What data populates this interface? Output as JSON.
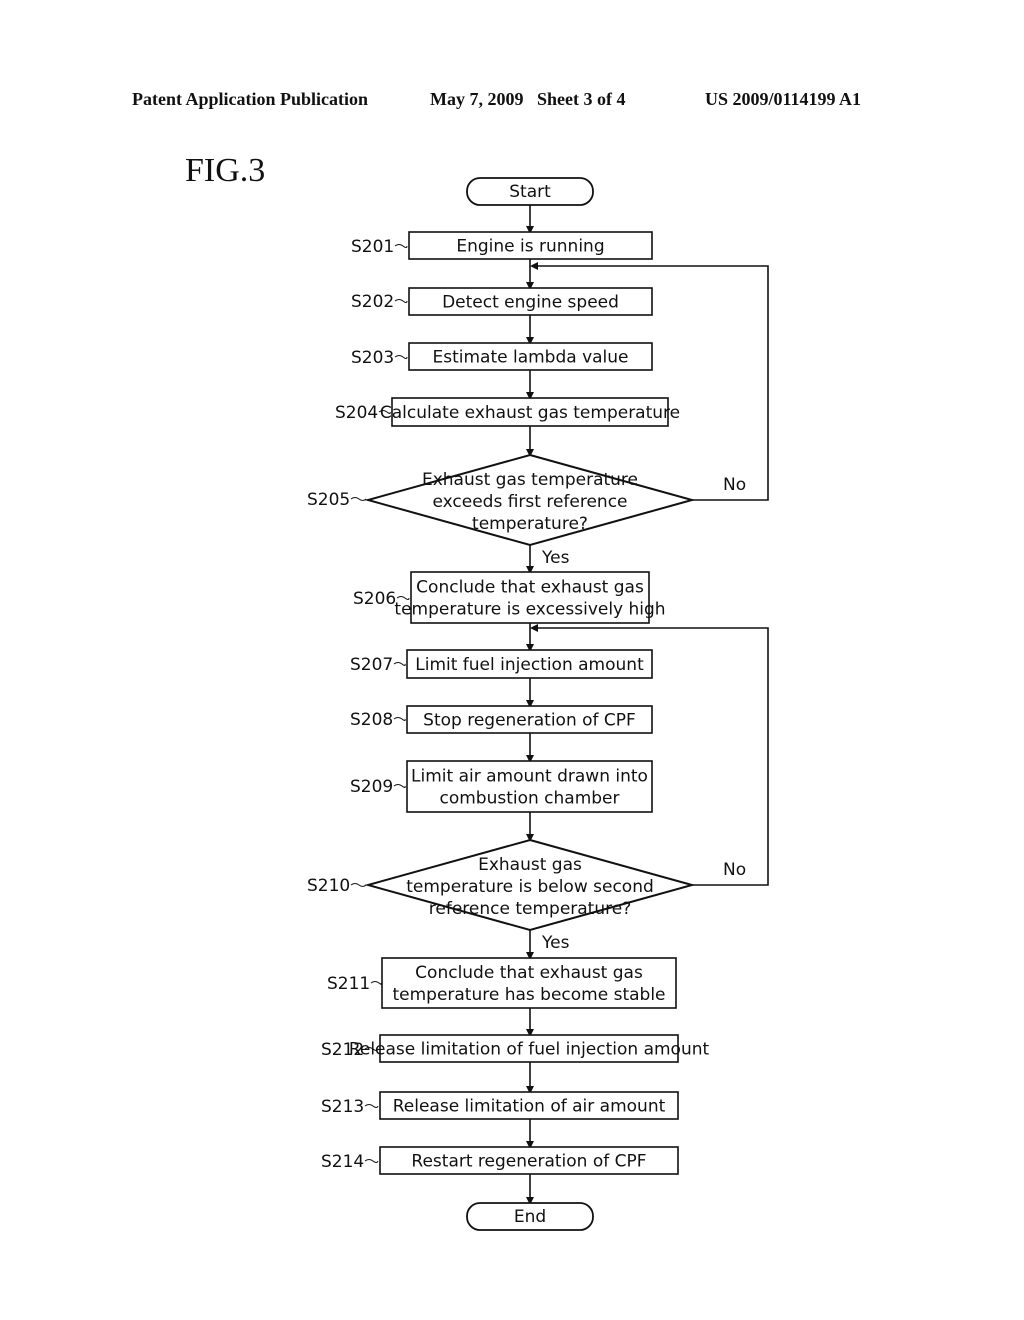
{
  "header": {
    "publication": "Patent Application Publication",
    "date_sheet": "May 7, 2009   Sheet 3 of 4",
    "number": "US 2009/0114199 A1"
  },
  "figure_label": "FIG.3",
  "flowchart": {
    "start": "Start",
    "end": "End",
    "steps": [
      {
        "id": "S201",
        "lines": [
          "Engine is running"
        ]
      },
      {
        "id": "S202",
        "lines": [
          "Detect engine speed"
        ]
      },
      {
        "id": "S203",
        "lines": [
          "Estimate lambda value"
        ]
      },
      {
        "id": "S204",
        "lines": [
          "Calculate exhaust gas temperature"
        ]
      },
      {
        "id": "S205",
        "type": "decision",
        "lines": [
          "Exhaust gas temperature",
          "exceeds first reference",
          "temperature?"
        ],
        "yes": "Yes",
        "no": "No",
        "no_target": "S202"
      },
      {
        "id": "S206",
        "lines": [
          "Conclude that exhaust gas",
          "temperature is excessively high"
        ]
      },
      {
        "id": "S207",
        "lines": [
          "Limit fuel injection amount"
        ]
      },
      {
        "id": "S208",
        "lines": [
          "Stop regeneration of CPF"
        ]
      },
      {
        "id": "S209",
        "lines": [
          "Limit air amount drawn into",
          "combustion chamber"
        ]
      },
      {
        "id": "S210",
        "type": "decision",
        "lines": [
          "Exhaust gas",
          "temperature is below second",
          "reference temperature?"
        ],
        "yes": "Yes",
        "no": "No",
        "no_target": "S207"
      },
      {
        "id": "S211",
        "lines": [
          "Conclude that exhaust gas",
          "temperature has become stable"
        ]
      },
      {
        "id": "S212",
        "lines": [
          "Release limitation of fuel injection amount"
        ]
      },
      {
        "id": "S213",
        "lines": [
          "Release limitation of air amount"
        ]
      },
      {
        "id": "S214",
        "lines": [
          "Restart regeneration of CPF"
        ]
      }
    ]
  }
}
